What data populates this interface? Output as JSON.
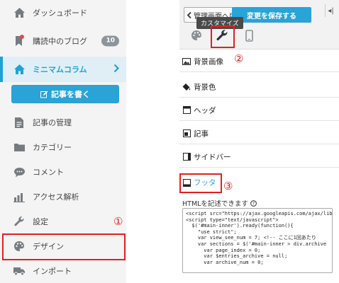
{
  "sidebar": {
    "items": [
      {
        "label": "ダッシュボード",
        "icon": "home-icon"
      },
      {
        "label": "購読中のブログ",
        "icon": "bookmark-icon",
        "badge": "10"
      },
      {
        "label": "ミニマムコラム",
        "icon": "blog-home-icon"
      },
      {
        "label": "記事の管理",
        "icon": "document-icon"
      },
      {
        "label": "カテゴリー",
        "icon": "folder-icon"
      },
      {
        "label": "コメント",
        "icon": "comment-icon"
      },
      {
        "label": "アクセス解析",
        "icon": "chart-icon"
      },
      {
        "label": "設定",
        "icon": "wrench-icon"
      },
      {
        "label": "デザイン",
        "icon": "palette-icon"
      },
      {
        "label": "インポート",
        "icon": "truck-icon"
      }
    ],
    "write_button": "記事を書く"
  },
  "editor": {
    "back_button": "管理画面へ戻る",
    "save_button": "変更を保存する",
    "collapse_button": "◂|",
    "tooltip": "カスタマイズ",
    "tabs": [
      {
        "icon": "palette-icon"
      },
      {
        "icon": "wrench-icon"
      },
      {
        "icon": "mobile-icon"
      }
    ],
    "sections": [
      {
        "label": "背景画像",
        "icon": "image-icon"
      },
      {
        "label": "背景色",
        "icon": "paint-bucket-icon"
      },
      {
        "label": "ヘッダ",
        "icon": "header-layout-icon"
      },
      {
        "label": "記事",
        "icon": "article-layout-icon"
      },
      {
        "label": "サイドバー",
        "icon": "sidebar-layout-icon"
      },
      {
        "label": "フッタ",
        "icon": "footer-layout-icon"
      }
    ],
    "html_label": "HTMLを記述できます",
    "code": "<script src=\"https://ajax.googleapis.com/ajax/libs\n<script type=\"text/javascript\">\n  $('#main-inner').ready(function(){\n    \"use strict\";\n    var view_see_num = 7; <!-- ここに1回あたり\n    var sections = $('#main-inner > div.archive\n      var page_index = 0;\n      var $entries_archive = null;\n      var archive_num = 0;"
  },
  "annotations": [
    "①",
    "②",
    "③"
  ],
  "colors": {
    "accent": "#2aa3d6",
    "annotation_red": "#e02020",
    "sidebar_bg": "#f4f4f4",
    "active_bg": "#e0eff6"
  }
}
